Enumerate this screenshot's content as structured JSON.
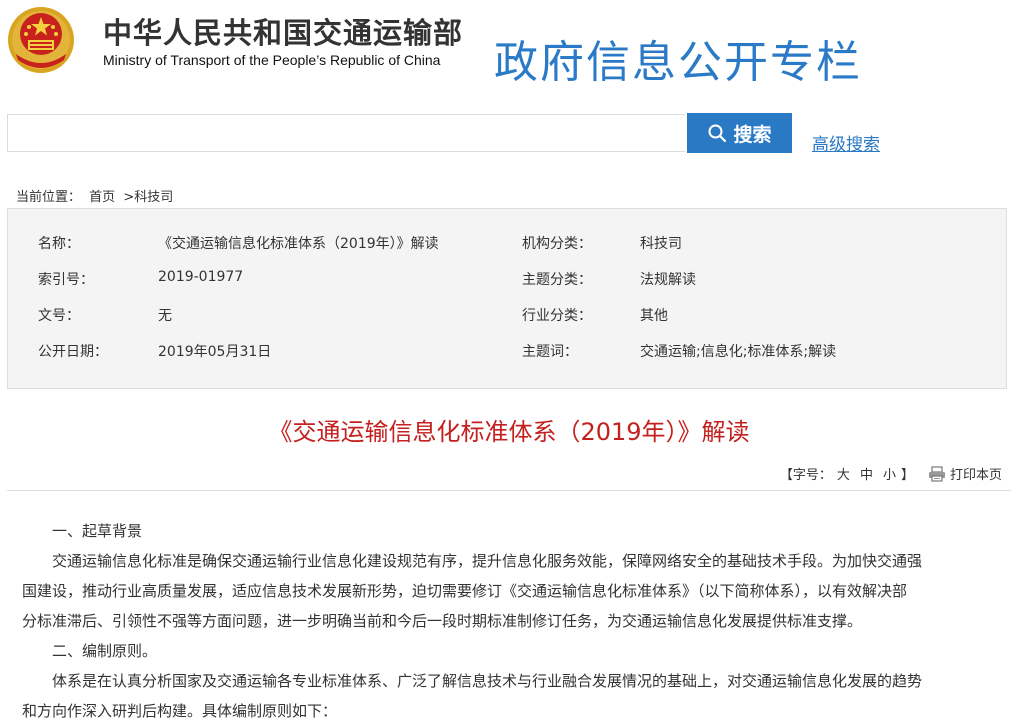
{
  "header": {
    "org_name_cn": "中华人民共和国交通运输部",
    "org_name_en": "Ministry of Transport of the People’s Republic of China",
    "column_title": "政府信息公开专栏"
  },
  "search": {
    "placeholder": "",
    "value": "",
    "button_label": "搜索",
    "advanced_label": "高级搜索"
  },
  "breadcrumb": {
    "prefix": "当前位置：",
    "home": "首页",
    "separator": ">",
    "current": "科技司"
  },
  "info": {
    "name_label": "名称：",
    "name_value": "《交通运输信息化标准体系（2019年）》解读",
    "index_label": "索引号：",
    "index_value": "2019-01977",
    "doc_no_label": "文号：",
    "doc_no_value": "无",
    "date_label": "公开日期：",
    "date_value": "2019年05月31日",
    "org_class_label": "机构分类：",
    "org_class_value": "科技司",
    "topic_class_label": "主题分类：",
    "topic_class_value": "法规解读",
    "industry_class_label": "行业分类：",
    "industry_class_value": "其他",
    "keywords_label": "主题词：",
    "keywords_value": "交通运输;信息化;标准体系;解读"
  },
  "document": {
    "title": "《交通运输信息化标准体系（2019年）》解读"
  },
  "font_bar": {
    "label_open": "【字号：",
    "large": "大",
    "medium": "中",
    "small": "小",
    "label_close": "】",
    "print_label": "打印本页"
  },
  "article": {
    "section1_heading": "一、起草背景",
    "section1_line1": "交通运输信息化标准是确保交通运输行业信息化建设规范有序，提升信息化服务效能，保障网络安全的基础技术手段。为加快交通强",
    "section1_line2": "国建设，推动行业高质量发展，适应信息技术发展新形势，迫切需要修订《交通运输信息化标准体系》（以下简称体系），以有效解决部",
    "section1_line3": "分标准滞后、引领性不强等方面问题，进一步明确当前和今后一段时期标准制修订任务，为交通运输信息化发展提供标准支撑。",
    "section2_heading": "二、编制原则。",
    "section2_line1": "体系是在认真分析国家及交通运输各专业标准体系、广泛了解信息技术与行业融合发展情况的基础上，对交通运输信息化发展的趋势",
    "section2_line2": "和方向作深入研判后构建。具体编制原则如下："
  },
  "colors": {
    "accent_blue": "#2a79c5",
    "title_red": "#c3201f",
    "info_bg": "#f4f4f4"
  }
}
